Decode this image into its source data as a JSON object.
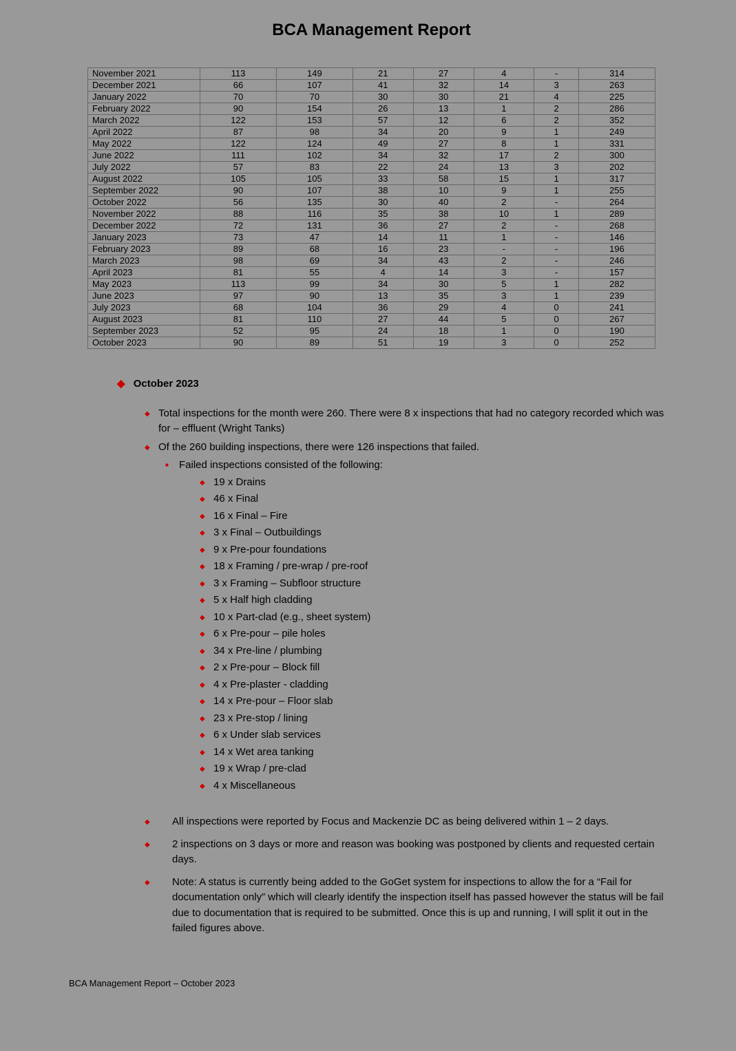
{
  "title": "BCA Management Report",
  "table": {
    "rows": [
      [
        "November 2021",
        "113",
        "149",
        "21",
        "27",
        "4",
        "-",
        "314"
      ],
      [
        "December 2021",
        "66",
        "107",
        "41",
        "32",
        "14",
        "3",
        "263"
      ],
      [
        "January 2022",
        "70",
        "70",
        "30",
        "30",
        "21",
        "4",
        "225"
      ],
      [
        "February 2022",
        "90",
        "154",
        "26",
        "13",
        "1",
        "2",
        "286"
      ],
      [
        "March 2022",
        "122",
        "153",
        "57",
        "12",
        "6",
        "2",
        "352"
      ],
      [
        "April 2022",
        "87",
        "98",
        "34",
        "20",
        "9",
        "1",
        "249"
      ],
      [
        "May 2022",
        "122",
        "124",
        "49",
        "27",
        "8",
        "1",
        "331"
      ],
      [
        "June 2022",
        "111",
        "102",
        "34",
        "32",
        "17",
        "2",
        "300"
      ],
      [
        "July 2022",
        "57",
        "83",
        "22",
        "24",
        "13",
        "3",
        "202"
      ],
      [
        "August 2022",
        "105",
        "105",
        "33",
        "58",
        "15",
        "1",
        "317"
      ],
      [
        "September 2022",
        "90",
        "107",
        "38",
        "10",
        "9",
        "1",
        "255"
      ],
      [
        "October 2022",
        "56",
        "135",
        "30",
        "40",
        "2",
        "-",
        "264"
      ],
      [
        "November 2022",
        "88",
        "116",
        "35",
        "38",
        "10",
        "1",
        "289"
      ],
      [
        "December 2022",
        "72",
        "131",
        "36",
        "27",
        "2",
        "-",
        "268"
      ],
      [
        "January 2023",
        "73",
        "47",
        "14",
        "11",
        "1",
        "-",
        "146"
      ],
      [
        "February 2023",
        "89",
        "68",
        "16",
        "23",
        "-",
        "-",
        "196"
      ],
      [
        "March 2023",
        "98",
        "69",
        "34",
        "43",
        "2",
        "-",
        "246"
      ],
      [
        "April 2023",
        "81",
        "55",
        "4",
        "14",
        "3",
        "-",
        "157"
      ],
      [
        "May 2023",
        "113",
        "99",
        "34",
        "30",
        "5",
        "1",
        "282"
      ],
      [
        "June 2023",
        "97",
        "90",
        "13",
        "35",
        "3",
        "1",
        "239"
      ],
      [
        "July 2023",
        "68",
        "104",
        "36",
        "29",
        "4",
        "0",
        "241"
      ],
      [
        "August 2023",
        "81",
        "110",
        "27",
        "44",
        "5",
        "0",
        "267"
      ],
      [
        "September 2023",
        "52",
        "95",
        "24",
        "18",
        "1",
        "0",
        "190"
      ],
      [
        "October 2023",
        "90",
        "89",
        "51",
        "19",
        "3",
        "0",
        "252"
      ]
    ]
  },
  "section_heading": "October 2023",
  "bullets_lvl1": [
    "Total inspections for the month were 260. There were 8 x inspections that had no category recorded which was for – effluent (Wright Tanks)",
    "Of the 260 building inspections, there were 126 inspections that failed."
  ],
  "lvl2_heading": "Failed inspections consisted of the following:",
  "failed_items": [
    "19 x Drains",
    "46 x Final",
    "16 x Final – Fire",
    "  3 x Final – Outbuildings",
    "  9 x Pre-pour foundations",
    "18 x Framing / pre-wrap / pre-roof",
    "  3 x Framing – Subfloor structure",
    "  5 x Half high cladding",
    "10 x Part-clad (e.g., sheet system)",
    "  6 x Pre-pour – pile holes",
    "34 x Pre-line / plumbing",
    "  2 x Pre-pour – Block fill",
    "  4 x Pre-plaster - cladding",
    "14 x Pre-pour – Floor slab",
    "23 x Pre-stop / lining",
    "  6 x Under slab services",
    "14 x Wet area tanking",
    "19 x Wrap / pre-clad",
    "  4 x Miscellaneous"
  ],
  "notes": [
    "All inspections were reported by Focus and Mackenzie DC as being delivered within 1 – 2 days.",
    "2 inspections on 3 days or more and reason was booking was postponed by clients and requested certain days.",
    "Note:  A status is currently being added to the GoGet system for inspections to allow the for a “Fail for documentation only” which will clearly identify the inspection itself has passed however the status will be fail due to documentation that is required to be submitted. Once this is up and running, I will split it out in the failed figures above."
  ],
  "footer": "BCA Management Report – October 2023"
}
